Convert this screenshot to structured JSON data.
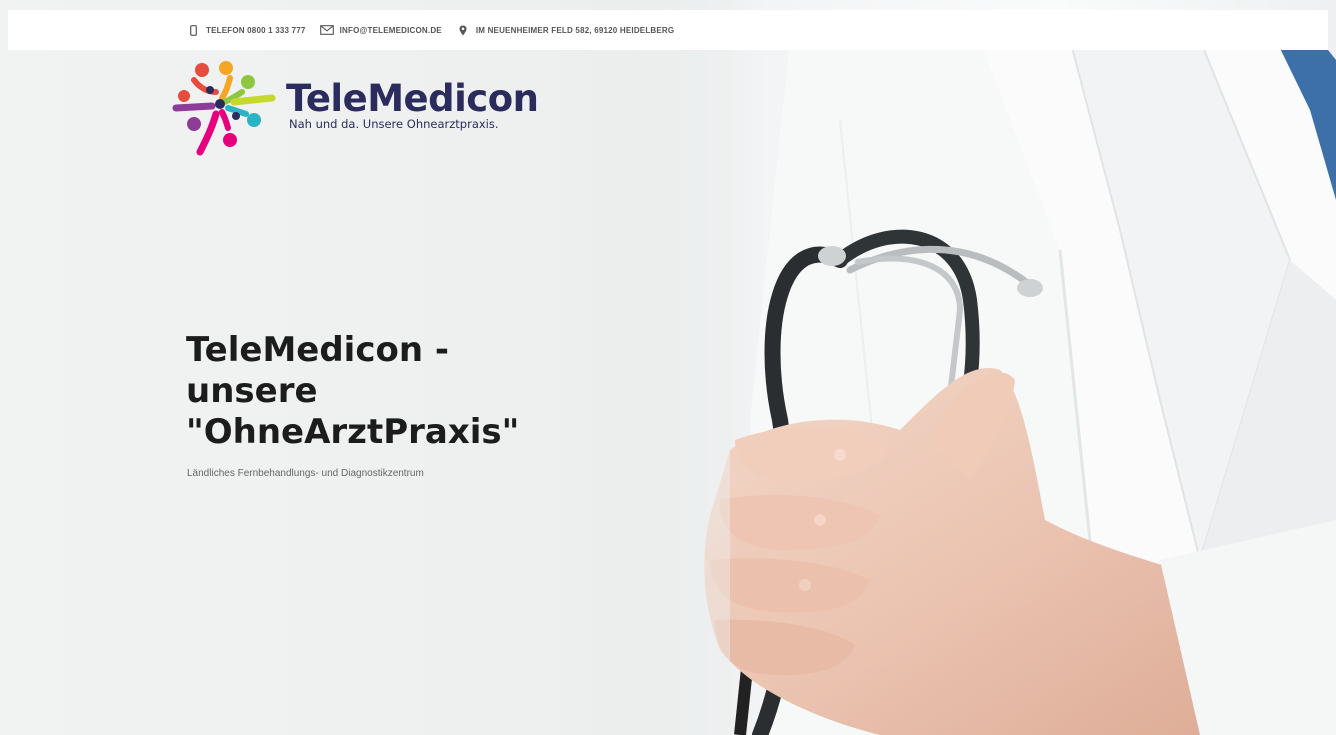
{
  "topbar": {
    "phone": "TELEFON 0800 1 333 777",
    "email": "INFO@TELEMEDICON.DE",
    "address": "IM NEUENHEIMER FELD 582, 69120 HEIDELBERG",
    "icons": [
      "phone-icon",
      "mail-icon",
      "location-pin-icon"
    ]
  },
  "logo": {
    "name": "TeleMedicon",
    "tagline": "Nah und da. Unsere Ohnearztpraxis.",
    "colors": [
      "#e74c3c",
      "#f5a623",
      "#8dc63f",
      "#2ab3c4",
      "#8e3c97",
      "#e6007e"
    ]
  },
  "hero": {
    "headline_line1": "TeleMedicon -",
    "headline_line2": "unsere",
    "headline_line3": "\"OhneArztPraxis\"",
    "subline": "Ländliches Fernbehandlungs- und Diagnostikzentrum"
  },
  "colors": {
    "brand_dark": "#2b2b5e",
    "headline": "#1c1c1c",
    "topbar_bg": "#ffffff"
  }
}
